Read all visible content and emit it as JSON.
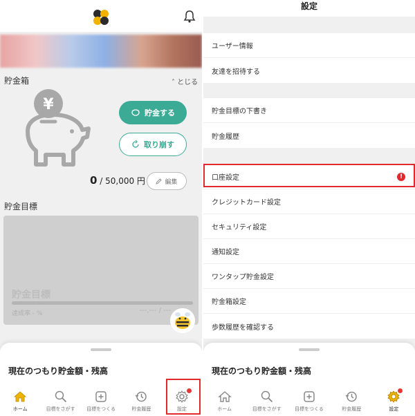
{
  "left": {
    "section_savings_box": "貯金箱",
    "close_toggle": "˄ とじる",
    "yen_symbol": "¥",
    "save_button": "貯金する",
    "withdraw_button": "取り崩す",
    "amount_current": "0",
    "amount_goal": "/ 50,000 円",
    "edit_button": "編集",
    "section_goal": "貯金目標",
    "goal_title": "貯金目標",
    "goal_rate": "達成率 - %",
    "goal_amount": "---,--- / ---",
    "sheet_title": "現在のつもり貯金額・残高"
  },
  "right": {
    "title": "設定",
    "group1": [
      "ユーザー情報",
      "友達を招待する"
    ],
    "group2": [
      "貯金目標の下書き",
      "貯金履歴"
    ],
    "group3": [
      "口座設定",
      "クレジットカード設定",
      "セキュリティ設定",
      "通知設定",
      "ワンタップ貯金設定",
      "貯金箱設定",
      "歩数履歴を確認する"
    ],
    "warning_mark": "!",
    "sheet_title": "現在のつもり貯金額・残高"
  },
  "tabs": [
    "ホーム",
    "目標をさがす",
    "目標をつくる",
    "貯金履歴",
    "設定"
  ],
  "colors": {
    "accent": "#3bab96",
    "highlight": "#e0282d",
    "active_tab": "#f0b400"
  },
  "icons": [
    "logo-icon",
    "bell-icon",
    "piggy-bank-icon",
    "home-icon",
    "search-icon",
    "plus-square-icon",
    "history-icon",
    "gear-icon"
  ]
}
